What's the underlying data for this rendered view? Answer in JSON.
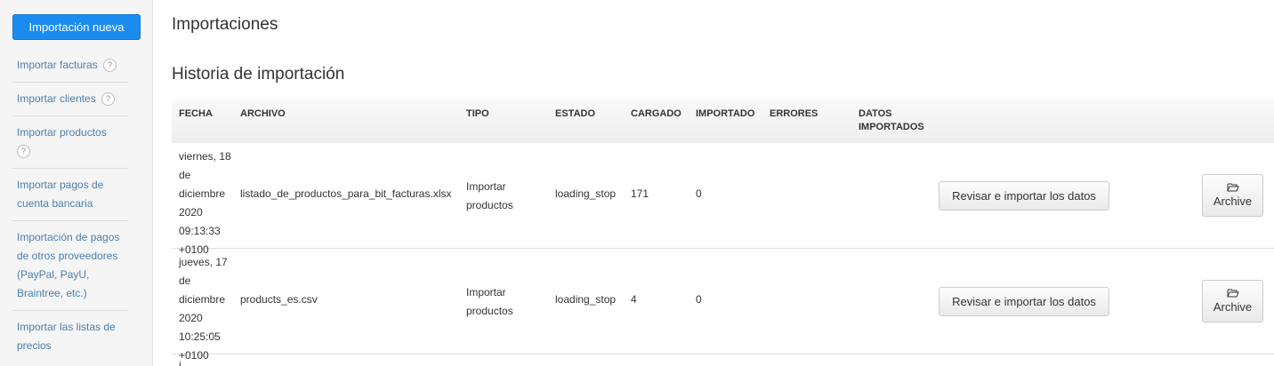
{
  "sidebar": {
    "new_import_label": "Importación nueva",
    "items": [
      {
        "label": "Importar facturas",
        "help": "?"
      },
      {
        "label": "Importar clientes",
        "help": "?"
      },
      {
        "label": "Importar productos",
        "help": "?"
      },
      {
        "label": "Importar pagos de cuenta bancaria"
      },
      {
        "label": "Importación de pagos de otros proveedores (PayPal, PayU, Braintree, etc.)"
      },
      {
        "label": "Importar las listas de precios"
      }
    ]
  },
  "main": {
    "title": "Importaciones",
    "history_title": "Historia de importación",
    "columns": {
      "fecha": "FECHA",
      "archivo": "ARCHIVO",
      "tipo": "TIPO",
      "estado": "ESTADO",
      "cargado": "CARGADO",
      "importado": "IMPORTADO",
      "errores": "ERRORES",
      "datos": "DATOS IMPORTADOS"
    },
    "rows": [
      {
        "date": "viernes, 18 de diciembre 2020 09:13:33 +0100",
        "file": "listado_de_productos_para_bit_facturas.xlsx",
        "type": "Importar productos",
        "status": "loading_stop",
        "loaded": "171",
        "imported": "0",
        "errors": "",
        "review_label": "Revisar e importar los datos",
        "archive_label": "Archive"
      },
      {
        "date": "jueves, 17 de diciembre 2020 10:25:05 +0100",
        "file": "products_es.csv",
        "type": "Importar productos",
        "status": "loading_stop",
        "loaded": "4",
        "imported": "0",
        "errors": "",
        "review_label": "Revisar e importar los datos",
        "archive_label": "Archive"
      }
    ],
    "partial_row_date": "j"
  },
  "icons": {
    "help": "help-circle-icon",
    "archive": "folder-open-icon"
  },
  "colors": {
    "primary": "#1a8cf0",
    "link": "#4a7fb0",
    "sidebar_bg": "#f5f5f5"
  }
}
